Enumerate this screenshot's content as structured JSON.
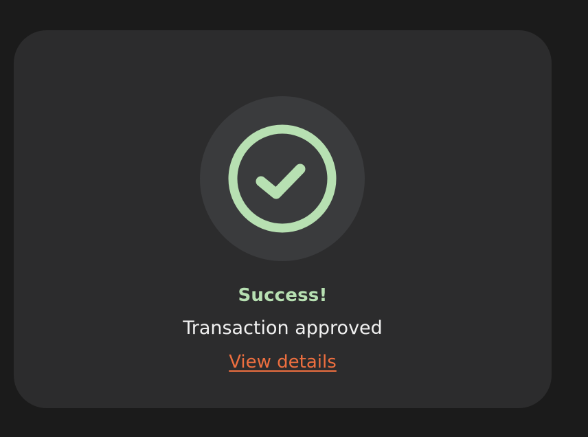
{
  "status": {
    "icon": "check-circle-icon",
    "title": "Success!",
    "message": "Transaction approved",
    "link_label": "View details"
  },
  "colors": {
    "page_background": "#1b1b1b",
    "card_background": "#2c2c2d",
    "icon_background": "#3a3b3d",
    "success": "#b7e0b2",
    "message_text": "#f1f1f1",
    "link": "#ee6f3f"
  }
}
